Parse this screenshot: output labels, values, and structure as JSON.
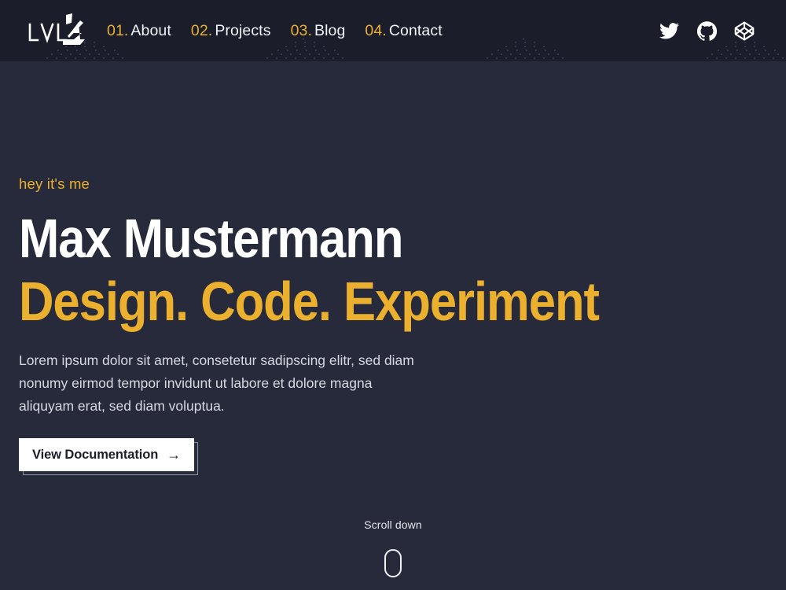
{
  "theme": {
    "header_bg": "#1b1d2a",
    "body_bg": "#272a3a",
    "accent": "#eab02e",
    "text_primary": "#ffffff",
    "text_muted": "#d6d9e2",
    "button_bg": "#ffffff",
    "button_text": "#1b1d2a"
  },
  "header": {
    "logo": {
      "text": "LVL",
      "icon": "lightning-bolt-mark"
    },
    "nav": [
      {
        "num": "01.",
        "label": "About"
      },
      {
        "num": "02.",
        "label": "Projects"
      },
      {
        "num": "03.",
        "label": "Blog"
      },
      {
        "num": "04.",
        "label": "Contact"
      }
    ],
    "socials": [
      {
        "name": "twitter-icon",
        "label": "Twitter"
      },
      {
        "name": "github-icon",
        "label": "GitHub"
      },
      {
        "name": "codepen-icon",
        "label": "CodePen"
      }
    ]
  },
  "hero": {
    "eyebrow": "hey it's me",
    "name": "Max Mustermann",
    "tagline": "Design. Code. Experiment",
    "lead": "Lorem ipsum dolor sit amet, consetetur sadipscing elitr, sed diam nonumy eirmod tempor invidunt ut labore et dolore magna aliquyam erat, sed diam voluptua.",
    "cta": {
      "label": "View Documentation",
      "arrow": "→"
    }
  },
  "scroll_indicator": {
    "label": "Scroll down",
    "icon": "mouse-outline-icon"
  }
}
